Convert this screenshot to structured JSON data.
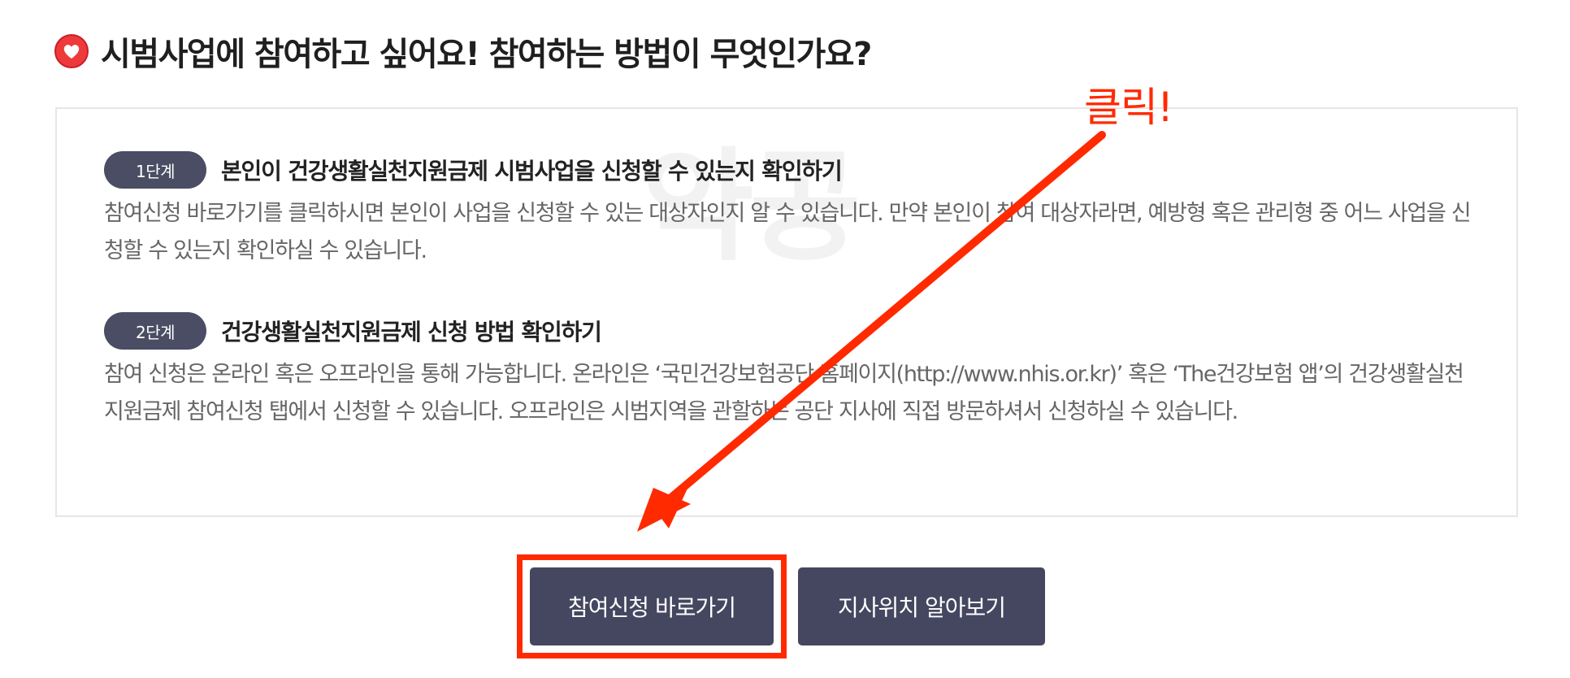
{
  "page": {
    "title": "시범사업에 참여하고 싶어요! 참여하는 방법이 무엇인가요?",
    "title_icon": "red-heart-circle-icon"
  },
  "watermark": "약공",
  "steps": [
    {
      "badge": "1단계",
      "title": "본인이 건강생활실천지원금제 시범사업을 신청할 수 있는지 확인하기",
      "description": "참여신청 바로가기를 클릭하시면 본인이 사업을 신청할 수 있는 대상자인지 알 수 있습니다. 만약 본인이 참여 대상자라면, 예방형 혹은 관리형 중 어느 사업을 신청할 수 있는지 확인하실 수 있습니다."
    },
    {
      "badge": "2단계",
      "title": "건강생활실천지원금제 신청 방법 확인하기",
      "description": "참여 신청은 온라인 혹은 오프라인을 통해 가능합니다. 온라인은 ‘국민건강보험공단 홈페이지(http://www.nhis.or.kr)’ 혹은 ‘The건강보험 앱’의 건강생활실천지원금제 참여신청 탭에서 신청할 수 있습니다. 오프라인은 시범지역을 관할하는 공단 지사에 직접 방문하셔서 신청하실 수 있습니다."
    }
  ],
  "buttons": {
    "apply_label": "참여신청 바로가기",
    "branch_label": "지사위치 알아보기"
  },
  "annotation": {
    "label": "클릭!",
    "color": "#ff2a00"
  },
  "colors": {
    "badge_bg": "#4a4d63",
    "button_bg": "#454760"
  }
}
